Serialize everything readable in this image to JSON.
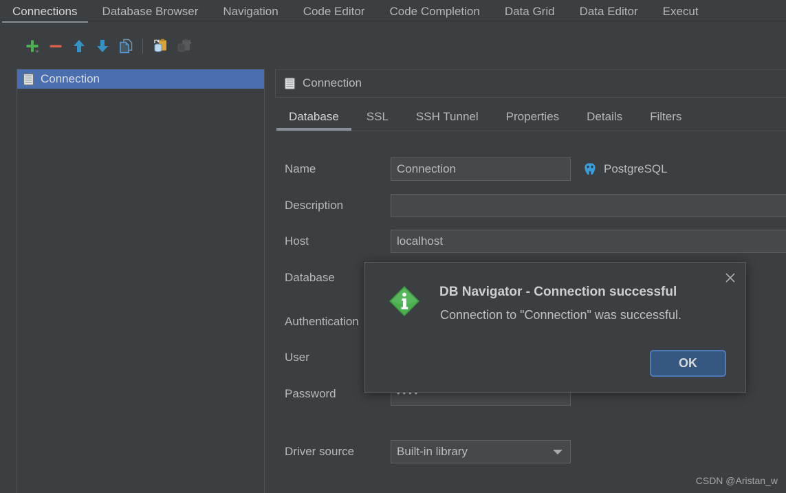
{
  "settings_tabs": [
    {
      "label": "Connections",
      "active": true
    },
    {
      "label": "Database Browser",
      "active": false
    },
    {
      "label": "Navigation",
      "active": false
    },
    {
      "label": "Code Editor",
      "active": false
    },
    {
      "label": "Code Completion",
      "active": false
    },
    {
      "label": "Data Grid",
      "active": false
    },
    {
      "label": "Data Editor",
      "active": false
    },
    {
      "label": "Execut",
      "active": false
    }
  ],
  "toolbar": {
    "buttons": [
      {
        "name": "add-connection-button",
        "icon": "plus-icon",
        "enabled": true
      },
      {
        "name": "remove-connection-button",
        "icon": "minus-icon",
        "enabled": true
      },
      {
        "name": "move-up-button",
        "icon": "arrow-up-icon",
        "enabled": true
      },
      {
        "name": "move-down-button",
        "icon": "arrow-down-icon",
        "enabled": true
      },
      {
        "name": "duplicate-connection-button",
        "icon": "copy-icon",
        "enabled": true
      },
      {
        "name": "export-connection-button",
        "icon": "database-export-icon",
        "enabled": true
      },
      {
        "name": "import-connection-button",
        "icon": "database-import-icon",
        "enabled": false
      }
    ]
  },
  "connection_list": {
    "items": [
      {
        "label": "Connection",
        "icon": "database-icon",
        "selected": true
      }
    ]
  },
  "detail": {
    "header_title": "Connection",
    "header_icon": "database-icon",
    "tabs": [
      {
        "label": "Database",
        "active": true
      },
      {
        "label": "SSL",
        "active": false
      },
      {
        "label": "SSH Tunnel",
        "active": false
      },
      {
        "label": "Properties",
        "active": false
      },
      {
        "label": "Details",
        "active": false
      },
      {
        "label": "Filters",
        "active": false
      }
    ],
    "fields": {
      "name_label": "Name",
      "name_value": "Connection",
      "db_type_label": "PostgreSQL",
      "description_label": "Description",
      "description_value": "",
      "host_label": "Host",
      "host_value": "localhost",
      "database_label": "Database",
      "authentication_label": "Authentication",
      "user_label": "User",
      "password_label": "Password",
      "password_value": "••••",
      "driver_source_label": "Driver source",
      "driver_source_value": "Built-in library"
    }
  },
  "dialog": {
    "title": "DB Navigator - Connection successful",
    "message": "Connection to \"Connection\" was successful.",
    "ok_label": "OK",
    "icon": "info-icon",
    "close_icon": "close-icon"
  },
  "watermark": "CSDN @Aristan_w",
  "colors": {
    "background": "#3c3f41",
    "selection_blue": "#4b6eaf",
    "accent_green": "#4caf50",
    "button_blue": "#365880",
    "postgres_blue": "#3a9ddb"
  }
}
